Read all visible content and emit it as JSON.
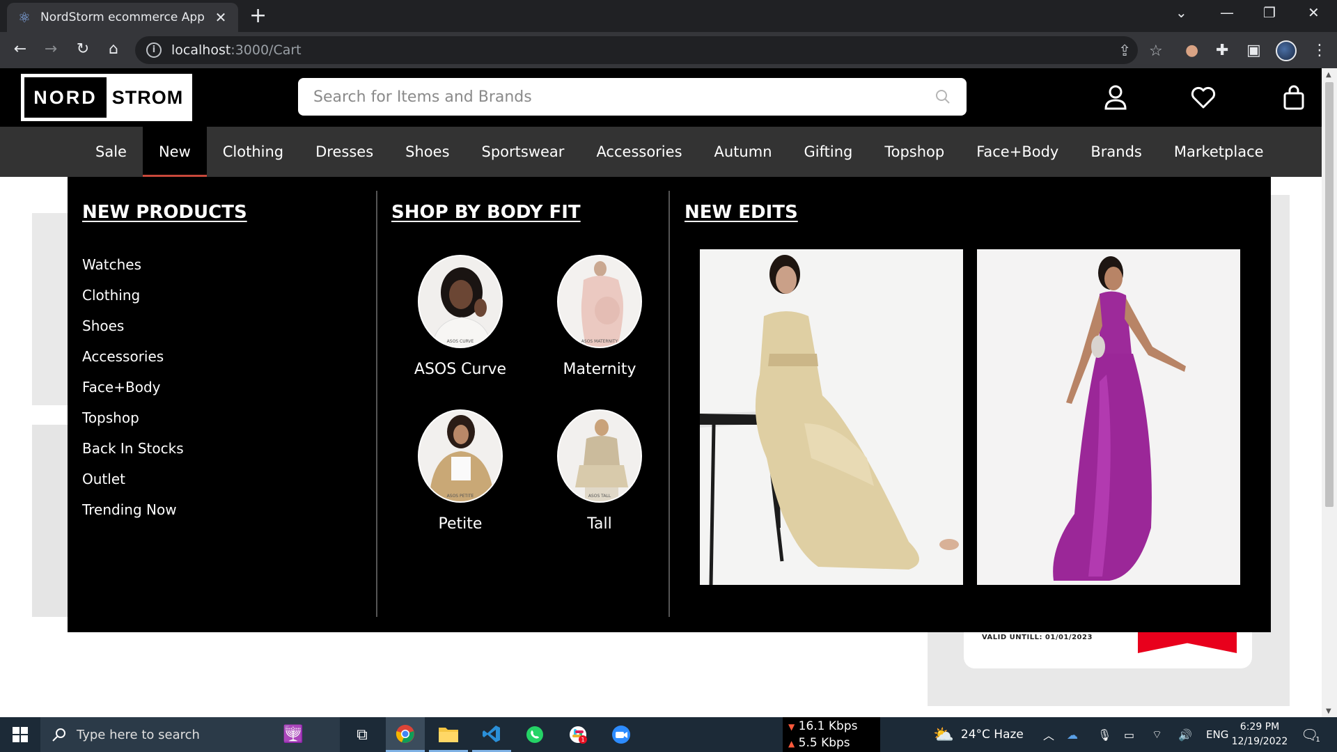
{
  "browser": {
    "tab_title": "NordStorm ecommerce App",
    "url_host": "localhost",
    "url_path": ":3000/Cart"
  },
  "site": {
    "logo_left": "NORD",
    "logo_right": "STROM",
    "search_placeholder": "Search for Items and Brands"
  },
  "nav": {
    "items": [
      "Sale",
      "New",
      "Clothing",
      "Dresses",
      "Shoes",
      "Sportswear",
      "Accessories",
      "Autumn",
      "Gifting",
      "Topshop",
      "Face+Body",
      "Brands",
      "Marketplace"
    ],
    "active": "New"
  },
  "mega": {
    "new_products": {
      "heading": "NEW PRODUCTS",
      "links": [
        "Watches",
        "Clothing",
        "Shoes",
        "Accessories",
        "Face+Body",
        "Topshop",
        "Back In Stocks",
        "Outlet",
        "Trending Now"
      ]
    },
    "body_fit": {
      "heading": "SHOP BY BODY FIT",
      "items": [
        {
          "label": "ASOS Curve",
          "tag": "ASOS CURVE"
        },
        {
          "label": "Maternity",
          "tag": "ASOS MATERNITY"
        },
        {
          "label": "Petite",
          "tag": "ASOS PETITE"
        },
        {
          "label": "Tall",
          "tag": "ASOS TALL"
        }
      ]
    },
    "new_edits": {
      "heading": "NEW EDITS"
    }
  },
  "background": {
    "coupon_valid": "VALID UNTILL: 01/01/2023",
    "ribbon_color": "#e8001c"
  },
  "taskbar": {
    "search_placeholder": "Type here to search",
    "net_down": "16.1 Kbps",
    "net_up": "5.5 Kbps",
    "weather": "24°C Haze",
    "language": "ENG",
    "time": "6:29 PM",
    "date": "12/19/2022",
    "notification_count": "1",
    "chat_badge": "1"
  },
  "colors": {
    "header_bg": "#000000",
    "nav_bg": "#333333",
    "nav_active_underline": "#c8483b",
    "taskbar_bg": "#1c2a37"
  }
}
